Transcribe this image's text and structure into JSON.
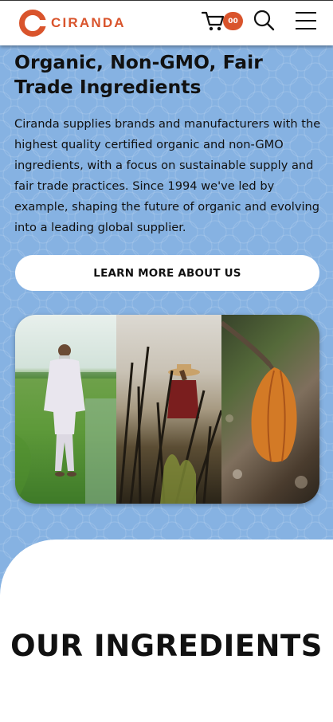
{
  "header": {
    "logo_text": "CIRANDA",
    "cart_count": "00",
    "brand_color": "#d9542c",
    "icons": [
      "cart-icon",
      "search-icon",
      "menu-icon"
    ]
  },
  "hero": {
    "title": "Organic, Non-GMO, Fair Trade Ingredients",
    "description": "Ciranda supplies brands and manufacturers with the highest quality certified organic and non-GMO ingredients, with a focus on sustainable supply and fair trade practices. Since 1994 we've led by example, shaping the future of organic and evolving into a leading global supplier.",
    "button_label": "LEARN MORE ABOUT US",
    "background_color": "#86b2e2"
  },
  "ingredients": {
    "title": "OUR INGREDIENTS"
  }
}
